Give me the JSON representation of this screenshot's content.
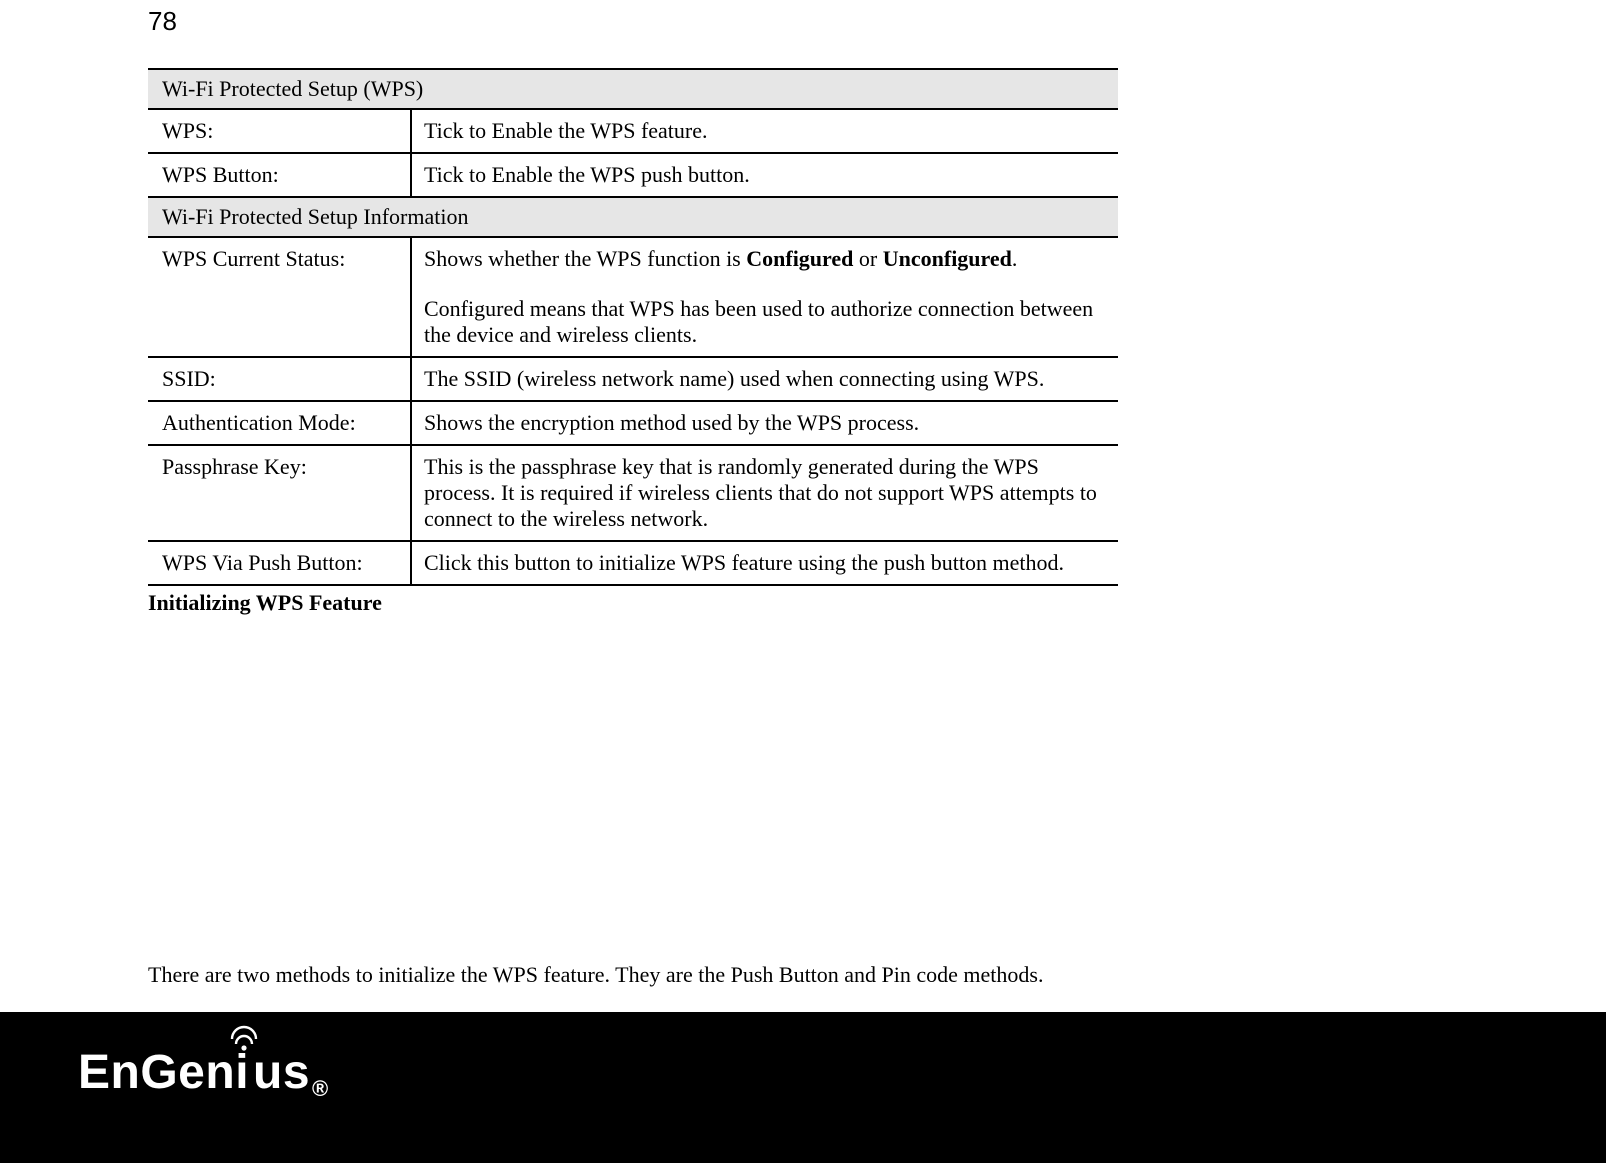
{
  "page_number": "78",
  "table": {
    "section1_header": "Wi-Fi Protected Setup (WPS)",
    "rows1": [
      {
        "label": "WPS:",
        "desc": "Tick to Enable the WPS feature."
      },
      {
        "label": "WPS Button:",
        "desc": "Tick to Enable the WPS push button."
      }
    ],
    "section2_header": "Wi-Fi Protected Setup Information",
    "status_row": {
      "label": "WPS Current Status:",
      "part_a": "Shows whether the WPS function is ",
      "bold_a": "Configured",
      "mid": " or ",
      "bold_b": "Unconfigured",
      "part_b": ".",
      "part_c": "Configured means that WPS has been used to authorize connection between the device and wireless clients."
    },
    "rows2": [
      {
        "label": "SSID:",
        "desc": "The SSID (wireless network name) used when connecting using WPS."
      },
      {
        "label": "Authentication Mode:",
        "desc": "Shows the encryption method used by the WPS process."
      },
      {
        "label": "Passphrase Key:",
        "desc": "This is the passphrase key that is randomly generated during the WPS process. It is required if wireless clients that do not support WPS attempts to connect to the wireless network."
      },
      {
        "label": "WPS Via Push Button:",
        "desc": "Click this button to initialize WPS feature using the push button method."
      }
    ]
  },
  "subheading": "Initializing WPS Feature",
  "body_text": "There are two methods to initialize the WPS feature. They are the Push Button and Pin code methods.",
  "logo": {
    "prefix": "EnGen",
    "i": "i",
    "suffix": "us",
    "reg": "®"
  }
}
